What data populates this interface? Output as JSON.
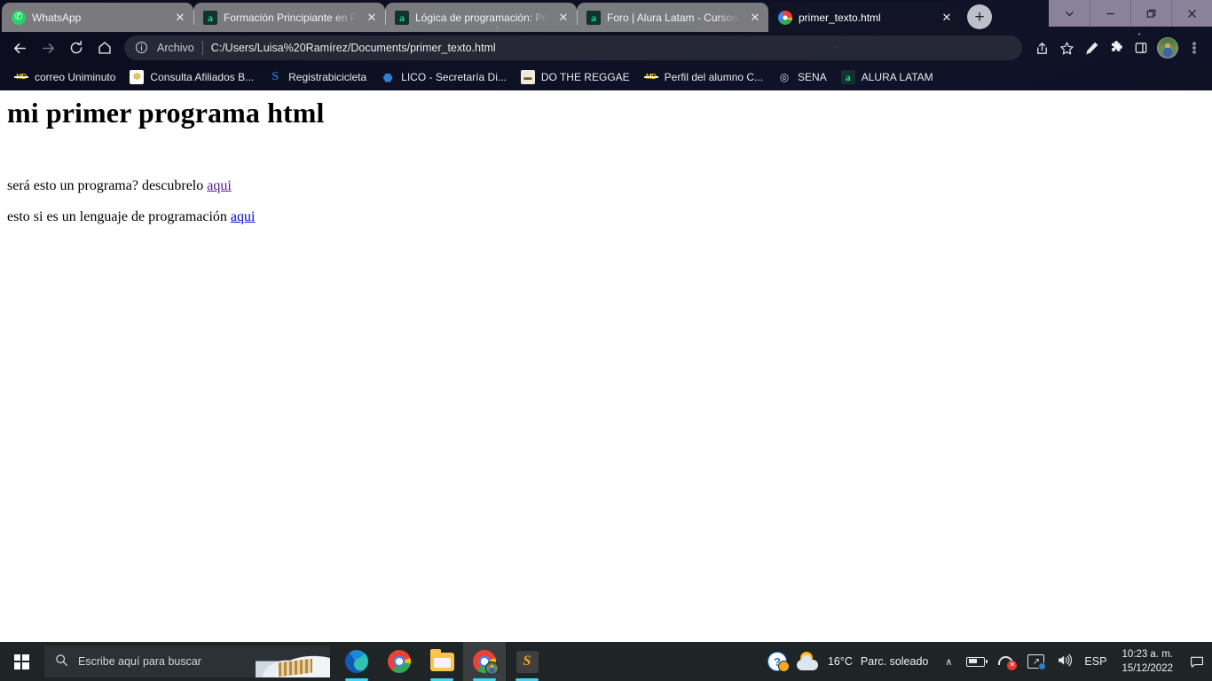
{
  "browser": {
    "tabs": [
      {
        "title": "WhatsApp",
        "favicon": "whatsapp-icon",
        "active": false,
        "close_label": "✕"
      },
      {
        "title": "Formación Principiante en Pr",
        "favicon": "alura-icon",
        "active": false,
        "close_label": "✕"
      },
      {
        "title": "Lógica de programación: Pri",
        "favicon": "alura-icon",
        "active": false,
        "close_label": "✕"
      },
      {
        "title": "Foro | Alura Latam - Cursos",
        "favicon": "alura-icon",
        "active": false,
        "close_label": "✕"
      },
      {
        "title": "primer_texto.html",
        "favicon": "chrome-icon",
        "active": true,
        "close_label": "✕"
      }
    ],
    "new_tab_label": "+",
    "window_controls": {
      "tab_search": "tab-search-chevron",
      "minimize": "minimize",
      "maximize": "maximize",
      "close": "close"
    },
    "toolbar": {
      "back": "back-arrow",
      "forward": "forward-arrow",
      "reload": "reload-arrow",
      "home": "home-house",
      "omnibox": {
        "info_icon": "info-circle-icon",
        "scheme_label": "Archivo",
        "url": "C:/Users/Luisa%20Ramírez/Documents/primer_texto.html"
      },
      "share": "share-icon",
      "bookmark_star": "star-icon",
      "highlighter": "pencil-highlighter-icon",
      "extensions": "puzzle-piece-icon",
      "side_panel": "side-panel-icon",
      "profile": "profile-avatar",
      "menu": "three-dot-menu-icon"
    },
    "bookmarks": [
      {
        "label": "correo Uniminuto",
        "icon": "uniminuto-icon",
        "glyph": "MD"
      },
      {
        "label": "Consulta Afiliados B...",
        "icon": "shield-crest-icon",
        "glyph": "☸"
      },
      {
        "label": "Registrabicicleta",
        "icon": "letter-s-icon",
        "glyph": "S"
      },
      {
        "label": "LICO - Secretaría Di...",
        "icon": "lico-icon",
        "glyph": "⬣"
      },
      {
        "label": "DO THE REGGAE",
        "icon": "reggae-icon",
        "glyph": "▬"
      },
      {
        "label": "Perfil del alumno C...",
        "icon": "uniminuto-icon",
        "glyph": "MD"
      },
      {
        "label": "SENA",
        "icon": "sena-icon",
        "glyph": "◎"
      },
      {
        "label": "ALURA LATAM",
        "icon": "alura-icon",
        "glyph": "a"
      }
    ]
  },
  "page": {
    "heading": "mi primer programa html",
    "paragraph1": {
      "text": "será esto un programa? descubrelo ",
      "link_label": "aqui",
      "link_state": "visited",
      "link_color": "#551a8b"
    },
    "paragraph2": {
      "text": "esto si es un lenguaje de programación ",
      "link_label": "aqui",
      "link_state": "unvisited",
      "link_color": "#0000ee"
    }
  },
  "taskbar": {
    "start": "windows-logo",
    "search": {
      "icon": "search-magnifier-icon",
      "placeholder": "Escribe aquí para buscar"
    },
    "apps": [
      {
        "name": "microsoft-edge",
        "running": true,
        "active": false
      },
      {
        "name": "google-chrome",
        "running": false,
        "active": false
      },
      {
        "name": "file-explorer",
        "running": true,
        "active": false
      },
      {
        "name": "google-chrome-profile",
        "running": true,
        "active": true
      },
      {
        "name": "sublime-text",
        "running": true,
        "active": false
      }
    ],
    "tray": {
      "help": {
        "icon": "help-question-icon",
        "glyph": "?"
      },
      "weather": {
        "icon": "sun-behind-cloud-icon",
        "temperature": "16°C",
        "condition": "Parc. soleado"
      },
      "overflow_chevron": "∧",
      "battery": "battery-icon",
      "headset": "headset-muted-icon",
      "network": "network-icon",
      "volume": "volume-icon",
      "language": "ESP",
      "time": "10:23 a. m.",
      "date": "15/12/2022",
      "notifications": "notification-icon"
    }
  }
}
